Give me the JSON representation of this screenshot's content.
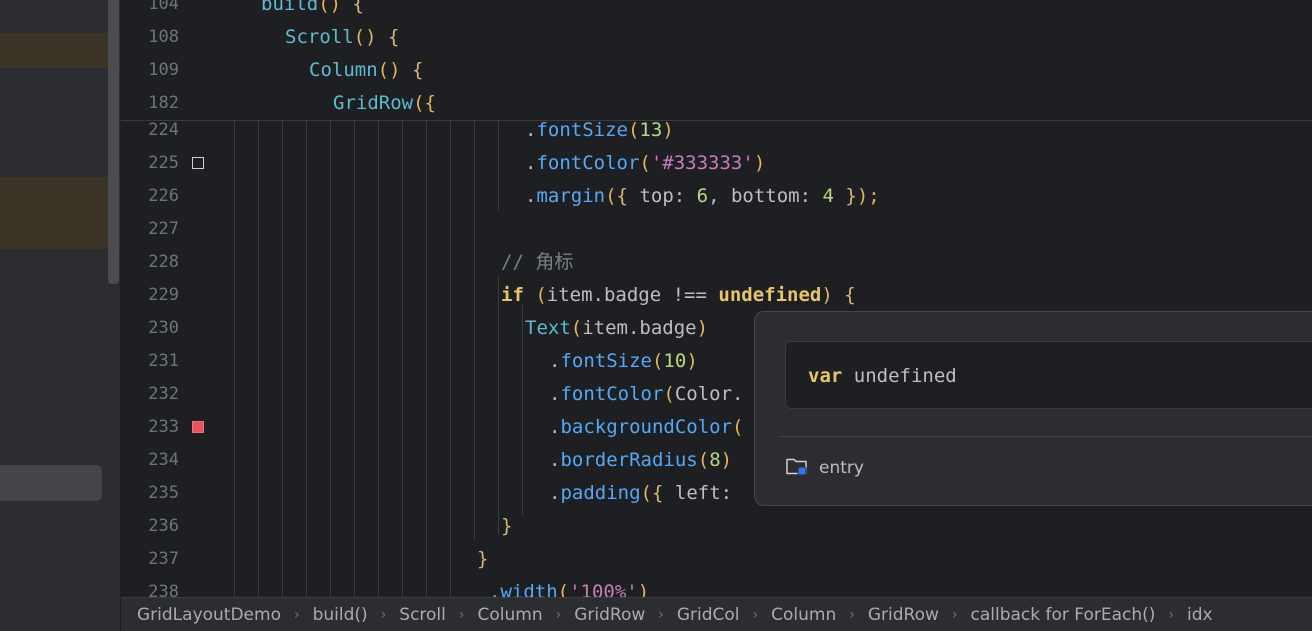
{
  "editor": {
    "sticky_lines": [
      {
        "ln": "104",
        "indent": 140,
        "tokens": [
          [
            "build",
            "t-ts"
          ],
          [
            "() ",
            "t-paren"
          ],
          [
            "{",
            "t-brace"
          ]
        ]
      },
      {
        "ln": "108",
        "indent": 164,
        "tokens": [
          [
            "Scroll",
            "t-ts"
          ],
          [
            "() ",
            "t-paren"
          ],
          [
            "{",
            "t-brace"
          ]
        ]
      },
      {
        "ln": "109",
        "indent": 188,
        "tokens": [
          [
            "Column",
            "t-ts"
          ],
          [
            "() ",
            "t-paren"
          ],
          [
            "{",
            "t-brace"
          ]
        ]
      },
      {
        "ln": "182",
        "indent": 212,
        "tokens": [
          [
            "GridRow",
            "t-ts"
          ],
          [
            "({",
            "t-paren"
          ]
        ]
      }
    ],
    "lines": [
      {
        "ln": "224",
        "indent": 404,
        "tokens": [
          [
            ".",
            ""
          ],
          [
            "fontSize",
            "t-call"
          ],
          [
            "(",
            "t-paren"
          ],
          [
            "13",
            "t-green"
          ],
          [
            ")",
            "t-paren"
          ]
        ]
      },
      {
        "ln": "225",
        "indent": 404,
        "tokens": [
          [
            ".",
            ""
          ],
          [
            "fontColor",
            "t-call"
          ],
          [
            "(",
            "t-paren"
          ],
          [
            "'#333333'",
            "t-str"
          ],
          [
            ")",
            "t-paren"
          ]
        ]
      },
      {
        "ln": "226",
        "indent": 404,
        "tokens": [
          [
            ".",
            ""
          ],
          [
            "margin",
            "t-call"
          ],
          [
            "(",
            "t-paren"
          ],
          [
            "{",
            "t-brace"
          ],
          [
            " top: ",
            ""
          ],
          [
            "6",
            "t-green"
          ],
          [
            ", bottom: ",
            ""
          ],
          [
            "4",
            "t-green"
          ],
          [
            " }",
            "t-brace"
          ],
          [
            ");",
            "t-paren"
          ]
        ]
      },
      {
        "ln": "227",
        "indent": 404,
        "tokens": []
      },
      {
        "ln": "228",
        "indent": 380,
        "tokens": [
          [
            "// 角标",
            "t-comment"
          ]
        ]
      },
      {
        "ln": "229",
        "indent": 380,
        "tokens": [
          [
            "if",
            "t-kw"
          ],
          [
            " (",
            "t-paren"
          ],
          [
            "item.badge !== ",
            ""
          ],
          [
            "undefined",
            "t-kw"
          ],
          [
            ") ",
            "t-paren"
          ],
          [
            "{",
            "t-brace"
          ]
        ]
      },
      {
        "ln": "230",
        "indent": 404,
        "tokens": [
          [
            "Text",
            "t-ts"
          ],
          [
            "(",
            "t-paren"
          ],
          [
            "item.badge",
            ""
          ],
          [
            ")",
            "t-paren"
          ]
        ]
      },
      {
        "ln": "231",
        "indent": 428,
        "tokens": [
          [
            ".",
            ""
          ],
          [
            "fontSize",
            "t-call"
          ],
          [
            "(",
            "t-paren"
          ],
          [
            "10",
            "t-green"
          ],
          [
            ")",
            "t-paren"
          ]
        ]
      },
      {
        "ln": "232",
        "indent": 428,
        "tokens": [
          [
            ".",
            ""
          ],
          [
            "fontColor",
            "t-call"
          ],
          [
            "(",
            "t-paren"
          ],
          [
            "Color.",
            ""
          ]
        ]
      },
      {
        "ln": "233",
        "indent": 428,
        "tokens": [
          [
            ".",
            ""
          ],
          [
            "backgroundColor",
            "t-call"
          ],
          [
            "(",
            "t-paren"
          ]
        ]
      },
      {
        "ln": "234",
        "indent": 428,
        "tokens": [
          [
            ".",
            ""
          ],
          [
            "borderRadius",
            "t-call"
          ],
          [
            "(",
            "t-paren"
          ],
          [
            "8",
            "t-green"
          ],
          [
            ")",
            "t-paren"
          ]
        ]
      },
      {
        "ln": "235",
        "indent": 428,
        "tokens": [
          [
            ".",
            ""
          ],
          [
            "padding",
            "t-call"
          ],
          [
            "(",
            "t-paren"
          ],
          [
            "{",
            "t-brace"
          ],
          [
            " left:",
            ""
          ]
        ]
      },
      {
        "ln": "236",
        "indent": 380,
        "tokens": [
          [
            "}",
            "t-brace"
          ]
        ]
      },
      {
        "ln": "237",
        "indent": 356,
        "tokens": [
          [
            "}",
            "t-brace"
          ]
        ]
      },
      {
        "ln": "238",
        "indent": 368,
        "tokens": [
          [
            ".width",
            "t-call"
          ],
          [
            "(",
            "t-paren"
          ],
          [
            "'100%'",
            "t-str"
          ],
          [
            ")",
            "t-paren"
          ]
        ]
      }
    ],
    "breakpoints": {
      "225": "outline",
      "233": "red"
    }
  },
  "popup": {
    "keyword": "var",
    "name": "undefined",
    "module_label": "entry",
    "module_icon": "folder-module-icon"
  },
  "breadcrumb": {
    "items": [
      "GridLayoutDemo",
      "build()",
      "Scroll",
      "Column",
      "GridRow",
      "GridCol",
      "Column",
      "GridRow",
      "callback for ForEach()",
      "idx"
    ]
  },
  "colors": {
    "background": "#1e1f22",
    "panel": "#2b2d30",
    "accent_blue": "#56a8f5",
    "keyword": "#e8c46a",
    "breakpoint": "#e55560"
  }
}
